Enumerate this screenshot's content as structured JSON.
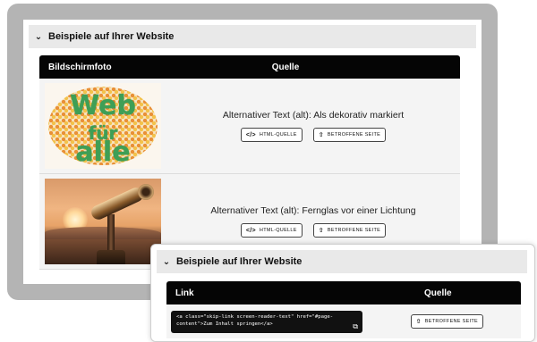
{
  "main_panel": {
    "section_title": "Beispiele auf Ihrer Website",
    "columns": [
      "Bildschirmfoto",
      "Quelle"
    ],
    "rows": [
      {
        "alt_text": "Alternativer Text (alt): Als dekorativ markiert",
        "image_text": [
          "Web",
          "für",
          "alle"
        ],
        "buttons": [
          "HTML-QUELLE",
          "BETROFFENE SEITE"
        ]
      },
      {
        "alt_text": "Alternativer Text (alt): Fernglas vor einer Lichtung",
        "buttons": [
          "HTML-QUELLE",
          "BETROFFENE SEITE"
        ]
      }
    ]
  },
  "overlay_panel": {
    "section_title": "Beispiele auf Ihrer Website",
    "columns": [
      "Link",
      "Quelle"
    ],
    "rows": [
      {
        "code_lines": [
          "<a class=\"skip-link screen-reader-text\" href=\"#page-",
          "content\">Zum Inhalt springen</a>"
        ],
        "button": "BETROFFENE SEITE"
      }
    ]
  },
  "icons": {
    "chevron": "chevron-down-icon",
    "code": "code-icon",
    "share": "share-icon",
    "copy": "copy-icon"
  },
  "colors": {
    "frame": "#b4b4b4",
    "table_header": "#050505",
    "accordion_bg": "#e9e9e9",
    "row_bg": "#f4f4f4"
  }
}
